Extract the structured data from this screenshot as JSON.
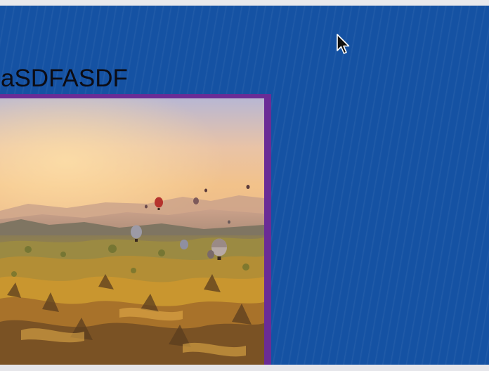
{
  "page": {
    "heading": "aSDFASDF"
  },
  "image": {
    "subject": "hot-air-balloons-over-valley"
  },
  "colors": {
    "background": "#1552a3",
    "frame_border": "#6a2c96",
    "heading_text": "#0c0c14"
  },
  "icons": {
    "cursor": "mouse-pointer-icon"
  }
}
